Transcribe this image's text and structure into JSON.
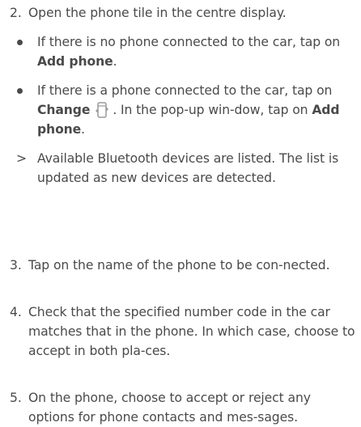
{
  "steps": [
    {
      "number": "2.",
      "text": "Open the phone tile in the centre display.",
      "bullets": [
        {
          "pre": "If there is no phone connected to the car, tap on ",
          "bold": "Add phone",
          "post": "."
        },
        {
          "pre": "If there is a phone connected to the car, tap on ",
          "bold": "Change",
          "icon": "phone-change-icon",
          "mid": ". In the pop-up win-dow, tap on ",
          "bold2": "Add phone",
          "post": "."
        }
      ],
      "result": {
        "mark": ">",
        "text": "Available Bluetooth devices are listed. The list is updated as new devices are detected."
      }
    },
    {
      "number": "3.",
      "text": "Tap on the name of the phone to be con-nected."
    },
    {
      "number": "4.",
      "text": "Check that the specified number code in the car matches that in the phone. In which case, choose to accept in both pla-ces."
    },
    {
      "number": "5.",
      "text": "On the phone, choose to accept or reject any options for phone contacts and mes-sages."
    }
  ],
  "colors": {
    "text": "#4a4a4a",
    "background": "#ffffff"
  }
}
